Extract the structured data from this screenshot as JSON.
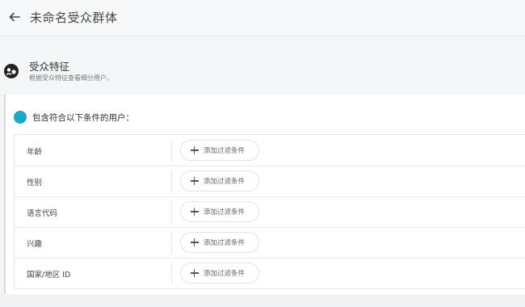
{
  "header": {
    "back_icon": "arrow-left-icon",
    "title": "未命名受众群体"
  },
  "section": {
    "icon": "audience-icon",
    "title": "受众特征",
    "description": "根据受众特征查看细分用户。"
  },
  "conditions": {
    "indicator_color": "#1ea7c7",
    "label": "包含符合以下条件的用户：",
    "rows": [
      {
        "label": "年龄",
        "add_label": "添加过滤条件"
      },
      {
        "label": "性别",
        "add_label": "添加过滤条件"
      },
      {
        "label": "语言代码",
        "add_label": "添加过滤条件"
      },
      {
        "label": "兴趣",
        "add_label": "添加过滤条件"
      },
      {
        "label": "国家/地区 ID",
        "add_label": "添加过滤条件"
      }
    ]
  }
}
